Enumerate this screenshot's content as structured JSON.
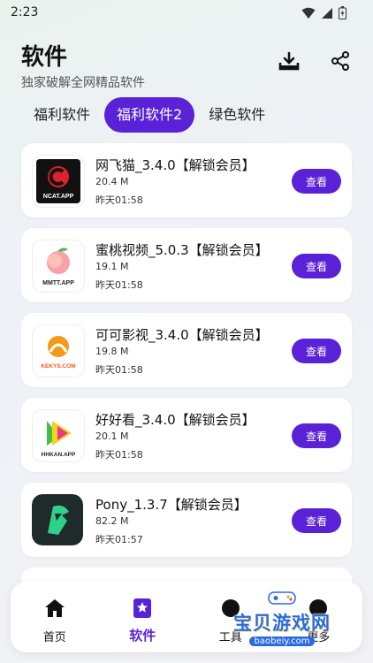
{
  "status_bar": {
    "time": "2:23",
    "icons": [
      "wifi-icon",
      "signal-icon",
      "battery-icon"
    ]
  },
  "header": {
    "title": "软件",
    "subtitle": "独家破解全网精品软件",
    "actions": [
      "download-icon",
      "share-icon"
    ]
  },
  "tabs": [
    {
      "label": "福利软件",
      "active": false
    },
    {
      "label": "福利软件2",
      "active": true
    },
    {
      "label": "绿色软件",
      "active": false
    }
  ],
  "apps": [
    {
      "name": "网飞猫_3.4.0【解锁会员】",
      "size": "20.4 M",
      "time": "昨天01:58",
      "button": "查看",
      "icon_text": "NCAT.APP",
      "icon": "ncat-app-icon"
    },
    {
      "name": "蜜桃视频_5.0.3【解锁会员】",
      "size": "19.1 M",
      "time": "昨天01:58",
      "button": "查看",
      "icon_text": "MMTT.APP",
      "icon": "peach-app-icon"
    },
    {
      "name": "可可影视_3.4.0【解锁会员】",
      "size": "19.8 M",
      "time": "昨天01:58",
      "button": "查看",
      "icon_text": "KEKYS.COM",
      "icon": "kekys-app-icon"
    },
    {
      "name": "好好看_3.4.0【解锁会员】",
      "size": "20.1 M",
      "time": "昨天01:58",
      "button": "查看",
      "icon_text": "HHKAN.APP",
      "icon": "hhkan-app-icon"
    },
    {
      "name": "Pony_1.3.7【解锁会员】",
      "size": "82.2 M",
      "time": "昨天01:57",
      "button": "查看",
      "icon_text": "",
      "icon": "pony-app-icon"
    }
  ],
  "bottom_nav": [
    {
      "label": "首页",
      "icon": "home-icon",
      "active": false
    },
    {
      "label": "软件",
      "icon": "software-icon",
      "active": true
    },
    {
      "label": "工具",
      "icon": "tools-icon",
      "active": false
    },
    {
      "label": "更多",
      "icon": "more-icon",
      "active": false
    }
  ],
  "watermark": {
    "text": "宝贝游戏网",
    "url": "baobeiy.com"
  },
  "colors": {
    "accent": "#5a22d6",
    "background": "#eef1f4",
    "card": "#ffffff"
  }
}
